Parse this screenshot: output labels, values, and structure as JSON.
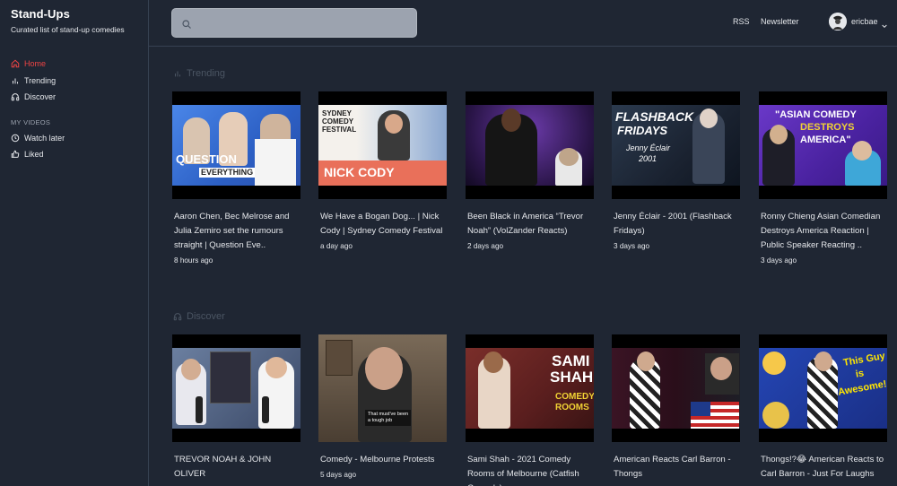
{
  "brand": {
    "title": "Stand-Ups",
    "subtitle": "Curated list of stand-up comedies"
  },
  "nav": {
    "items": [
      {
        "label": "Home",
        "icon": "home-icon",
        "active": true
      },
      {
        "label": "Trending",
        "icon": "bar-chart-icon",
        "active": false
      },
      {
        "label": "Discover",
        "icon": "headphones-icon",
        "active": false
      }
    ],
    "my_videos_heading": "MY VIDEOS",
    "my_videos": [
      {
        "label": "Watch later",
        "icon": "clock-icon"
      },
      {
        "label": "Liked",
        "icon": "thumbs-up-icon"
      }
    ]
  },
  "header": {
    "search": {
      "value": "",
      "placeholder": ""
    },
    "links": [
      "RSS",
      "Newsletter"
    ],
    "user": {
      "name": "ericbae"
    }
  },
  "sections": [
    {
      "title": "Trending",
      "icon": "bar-chart-icon",
      "videos": [
        {
          "title": "Aaron Chen, Bec Melrose and Julia Zemiro set the rumours straight | Question Eve..",
          "time": "8 hours ago",
          "thumb_text": [
            "QUESTION",
            "EVERYTHING"
          ],
          "thumb_color": "#3b6fd1"
        },
        {
          "title": "We Have a Bogan Dog... | Nick Cody | Sydney Comedy Festival",
          "time": "a day ago",
          "thumb_text": [
            "SYDNEY COMEDY FESTIVAL",
            "NICK CODY"
          ],
          "thumb_color": "#f2f0ee"
        },
        {
          "title": "Been Black in America “Trevor Noah” (VolZander Reacts)",
          "time": "2 days ago",
          "thumb_text": [],
          "thumb_color": "#3a1f5c"
        },
        {
          "title": "Jenny Éclair - 2001 (Flashback Fridays)",
          "time": "3 days ago",
          "thumb_text": [
            "FLASHBACK",
            "FRIDAYS",
            "Jenny Éclair",
            "2001"
          ],
          "thumb_color": "#1d2a3a"
        },
        {
          "title": "Ronny Chieng Asian Comedian Destroys America Reaction | Public Speaker Reacting ..",
          "time": "3 days ago",
          "thumb_text": [
            "\"ASIAN COMEDY",
            "DESTROYS",
            "AMERICA\""
          ],
          "thumb_color": "#5b2ca6"
        }
      ]
    },
    {
      "title": "Discover",
      "icon": "headphones-icon",
      "videos": [
        {
          "title": "TREVOR NOAH & JOHN OLIVER",
          "time": "",
          "thumb_text": [],
          "thumb_color": "#4a5a78"
        },
        {
          "title": "Comedy - Melbourne Protests",
          "time": "5 days ago",
          "thumb_text": [
            "That must've been",
            "a tough job"
          ],
          "thumb_color": "#6b5a4a"
        },
        {
          "title": "Sami Shah - 2021 Comedy Rooms of Melbourne (Catfish Comedy)",
          "time": "",
          "thumb_text": [
            "SAMI",
            "SHAH",
            "COMEDY",
            "ROOMS"
          ],
          "thumb_color": "#6e2a2a"
        },
        {
          "title": "American Reacts Carl Barron - Thongs",
          "time": "",
          "thumb_text": [],
          "thumb_color": "#3a1a2a"
        },
        {
          "title": "Thongs!?😂 American Reacts to Carl Barron - Just For Laughs",
          "time": "",
          "thumb_text": [
            "This Guy",
            "is",
            "Awesome!"
          ],
          "thumb_color": "#1e3a9c"
        }
      ]
    }
  ],
  "colors": {
    "background": "#1f2633",
    "active": "#ef4444",
    "muted": "#4b5563",
    "search": "#9ca3af"
  }
}
